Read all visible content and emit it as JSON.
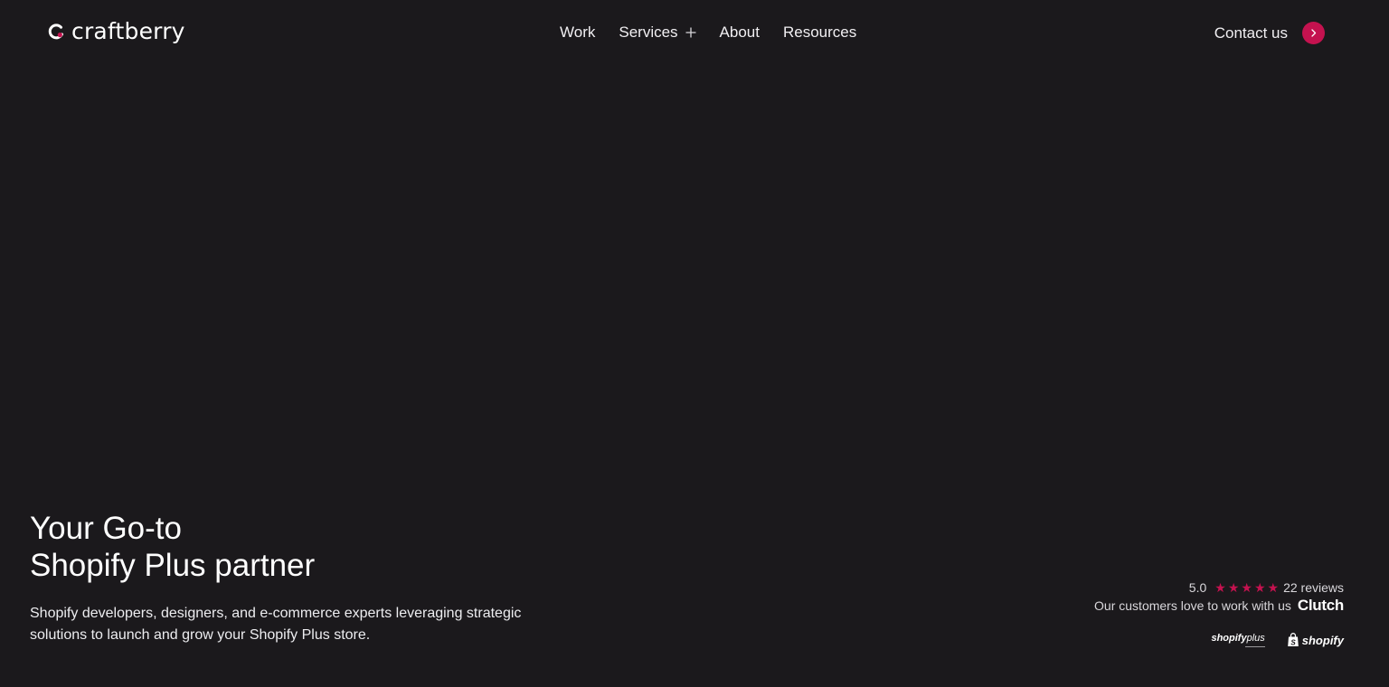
{
  "header": {
    "logo_text": "craftberry",
    "nav": [
      {
        "label": "Work"
      },
      {
        "label": "Services"
      },
      {
        "label": "About"
      },
      {
        "label": "Resources"
      }
    ],
    "contact_label": "Contact us"
  },
  "hero": {
    "title_line1": "Your Go-to",
    "title_line2": "Shopify Plus partner",
    "subtitle": "Shopify developers, designers, and e-commerce experts leveraging strategic solutions to launch and grow your Shopify Plus store."
  },
  "reviews": {
    "rating": "5.0",
    "stars": 5,
    "count_label": "22 reviews",
    "tagline": "Our customers love to work with us",
    "brand": "Clutch",
    "badge_plus": "shopify",
    "badge_plus_suffix": "plus",
    "badge_shopify": "shopify"
  },
  "colors": {
    "background": "#1b191c",
    "accent": "#c4124f",
    "text": "#ffffff"
  },
  "icons": {
    "logo": "craftberry-logo-icon",
    "services_expand": "plus-icon",
    "contact": "chevron-right-icon",
    "star": "star-icon",
    "shopify_bag": "shopping-bag-icon"
  }
}
